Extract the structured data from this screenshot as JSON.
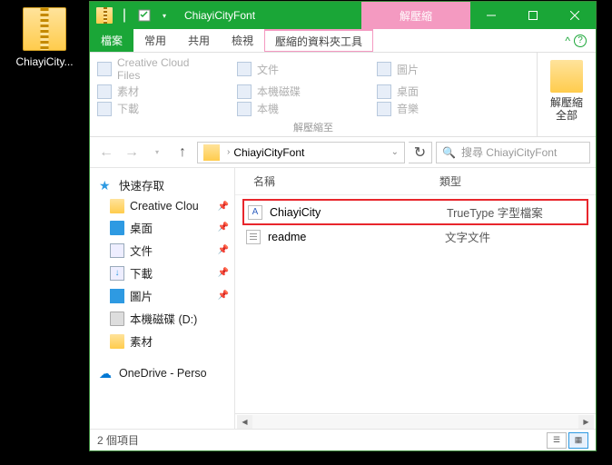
{
  "desktop": {
    "icon_label": "ChiayiCity..."
  },
  "titlebar": {
    "title": "ChiayiCityFont",
    "context_tab": "解壓縮"
  },
  "tabs": {
    "file": "檔案",
    "home": "常用",
    "share": "共用",
    "view": "檢視",
    "compressed": "壓縮的資料夾工具"
  },
  "ribbon": {
    "items": [
      "Creative Cloud Files",
      "文件",
      "圖片",
      "素材",
      "本機磁碟",
      "桌面",
      "下載",
      "本機",
      "音樂"
    ],
    "panel_label": "解壓縮至",
    "extract_all": "解壓縮\n全部"
  },
  "nav": {
    "breadcrumb": "ChiayiCityFont",
    "search_placeholder": "搜尋 ChiayiCityFont"
  },
  "sidebar": {
    "quick_access": "快速存取",
    "items": [
      {
        "label": "Creative Clou",
        "pin": true
      },
      {
        "label": "桌面",
        "pin": true
      },
      {
        "label": "文件",
        "pin": true
      },
      {
        "label": "下載",
        "pin": true
      },
      {
        "label": "圖片",
        "pin": true
      },
      {
        "label": "本機磁碟 (D:)",
        "pin": false
      },
      {
        "label": "素材",
        "pin": false
      }
    ],
    "onedrive": "OneDrive - Perso"
  },
  "columns": {
    "name": "名稱",
    "type": "類型"
  },
  "files": [
    {
      "name": "ChiayiCity",
      "type": "TrueType 字型檔案",
      "highlight": true,
      "icon": "font"
    },
    {
      "name": "readme",
      "type": "文字文件",
      "highlight": false,
      "icon": "txt"
    }
  ],
  "status": {
    "count": "2 個項目"
  }
}
